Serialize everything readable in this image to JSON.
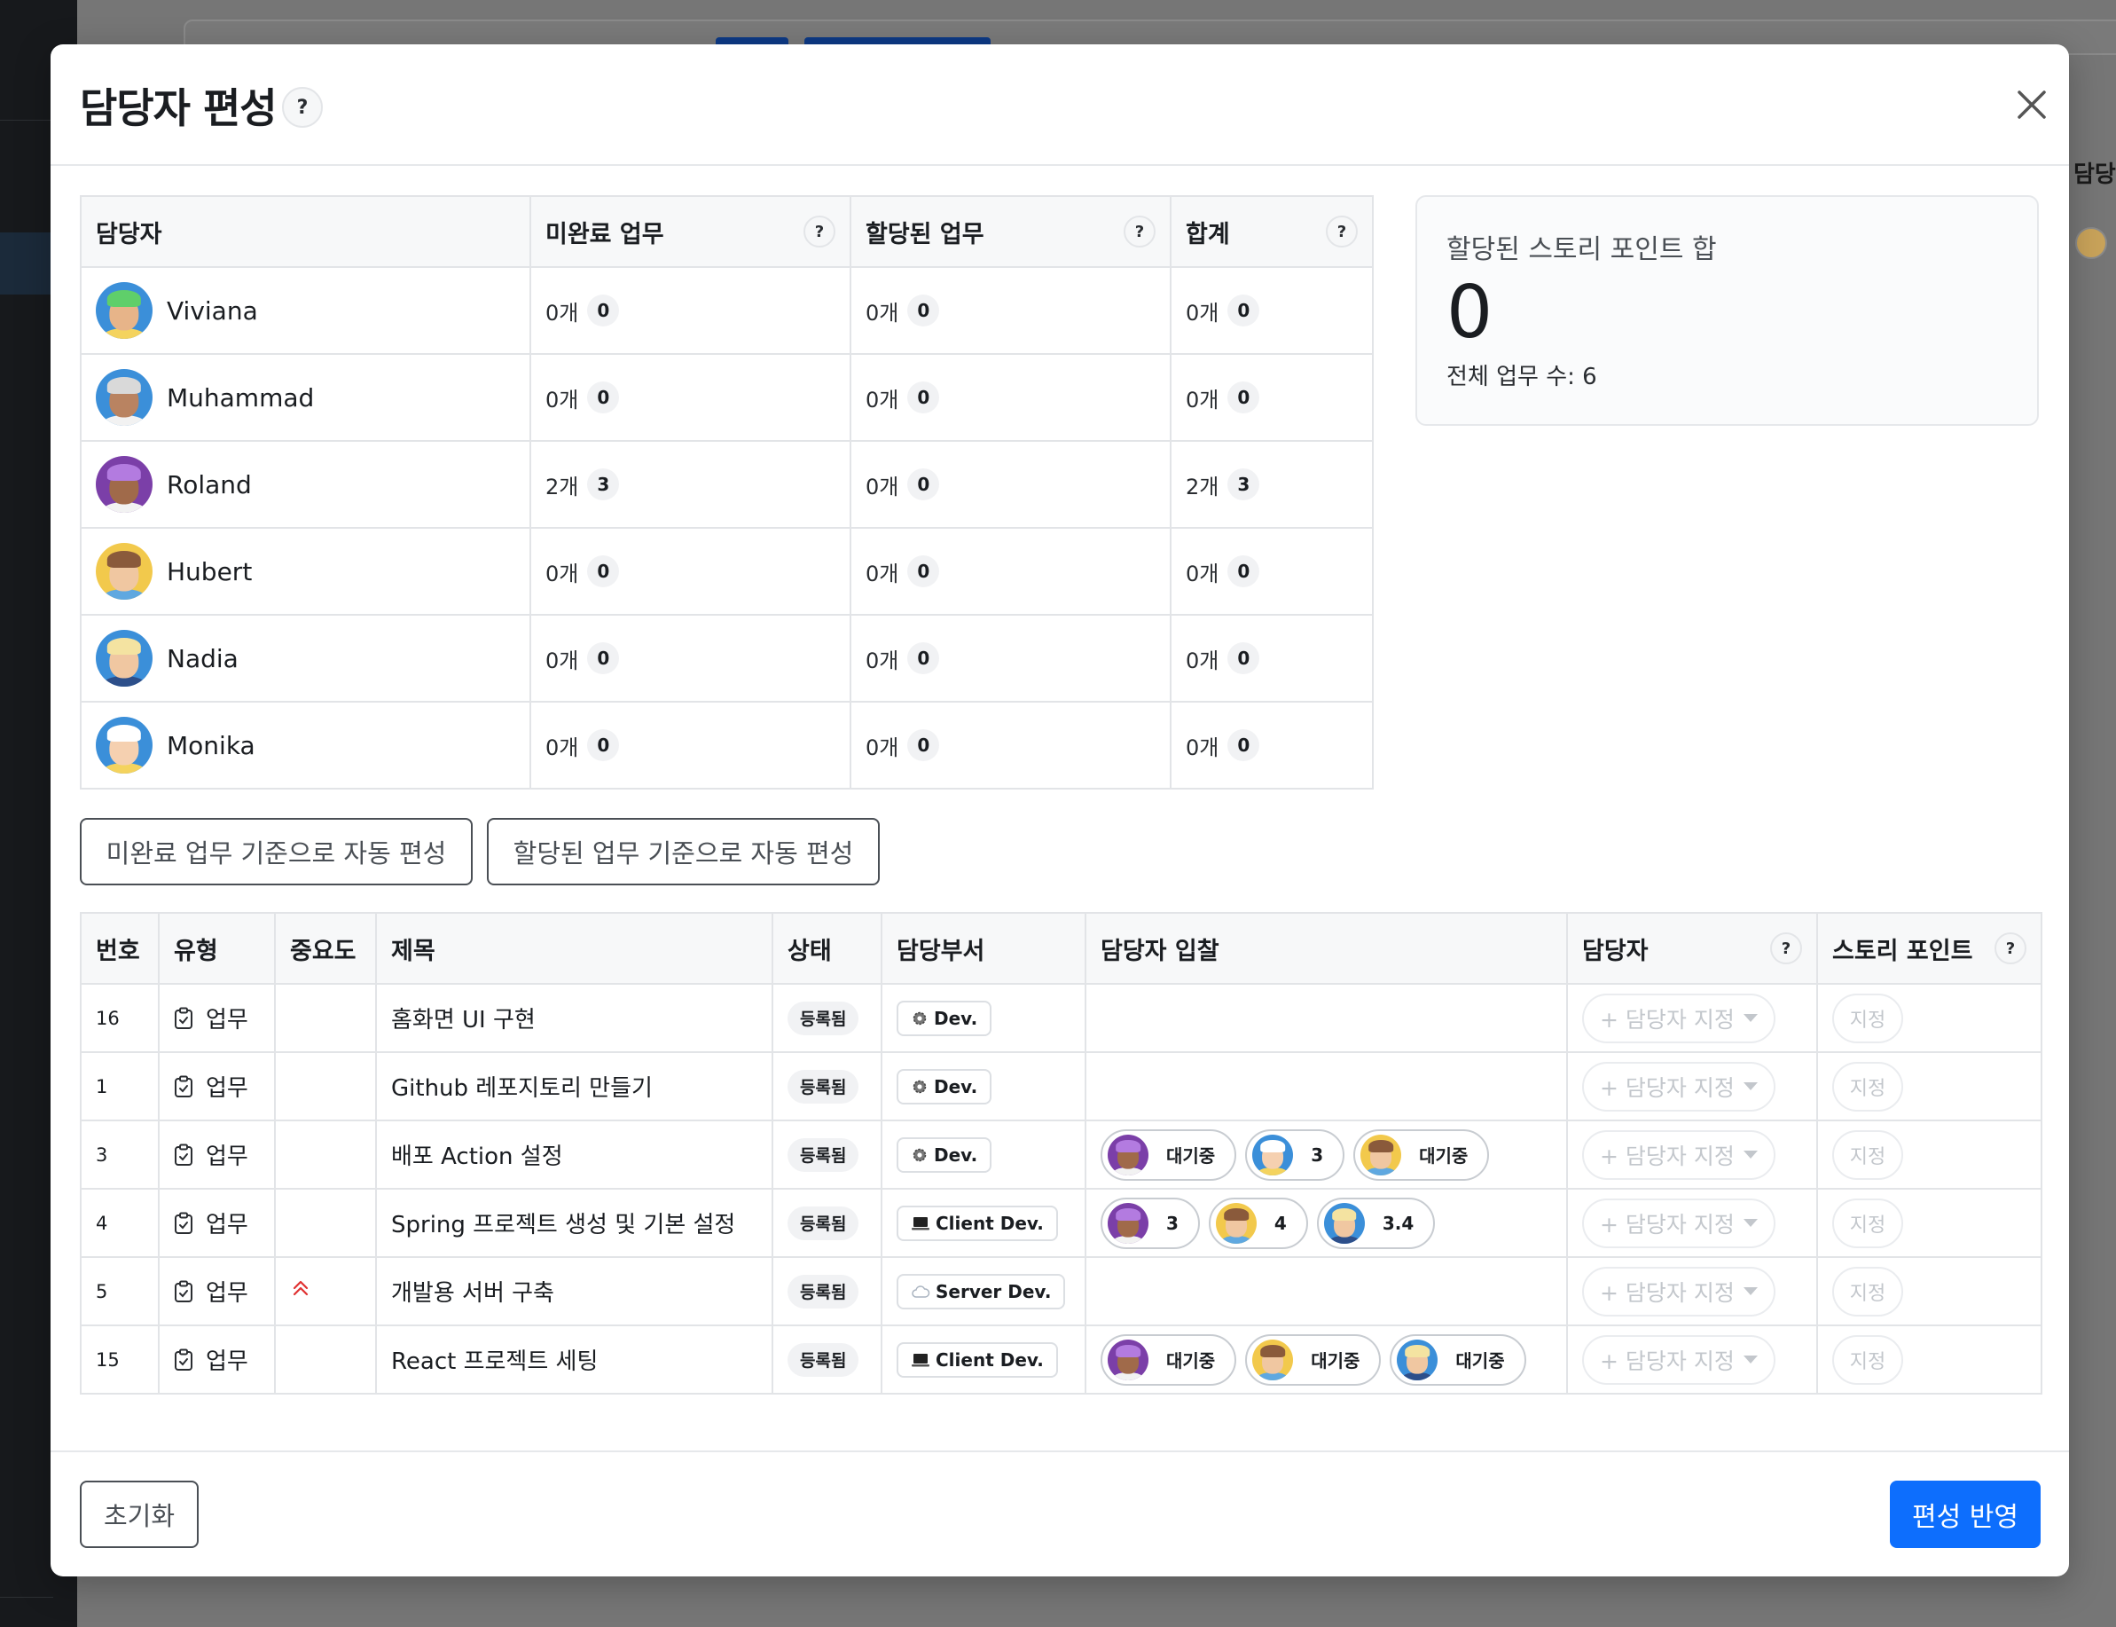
{
  "background": {
    "column_header": "담당"
  },
  "modal": {
    "title": "담당자 편성",
    "help": "?"
  },
  "summary": {
    "headers": {
      "assignee": "담당자",
      "incomplete": "미완료 업무",
      "assigned": "할당된 업무",
      "total": "합계"
    },
    "rows": [
      {
        "name": "Viviana",
        "incomplete_count": "0개",
        "incomplete_points": "0",
        "assigned_count": "0개",
        "assigned_points": "0",
        "total_count": "0개",
        "total_points": "0"
      },
      {
        "name": "Muhammad",
        "incomplete_count": "0개",
        "incomplete_points": "0",
        "assigned_count": "0개",
        "assigned_points": "0",
        "total_count": "0개",
        "total_points": "0"
      },
      {
        "name": "Roland",
        "incomplete_count": "2개",
        "incomplete_points": "3",
        "assigned_count": "0개",
        "assigned_points": "0",
        "total_count": "2개",
        "total_points": "3"
      },
      {
        "name": "Hubert",
        "incomplete_count": "0개",
        "incomplete_points": "0",
        "assigned_count": "0개",
        "assigned_points": "0",
        "total_count": "0개",
        "total_points": "0"
      },
      {
        "name": "Nadia",
        "incomplete_count": "0개",
        "incomplete_points": "0",
        "assigned_count": "0개",
        "assigned_points": "0",
        "total_count": "0개",
        "total_points": "0"
      },
      {
        "name": "Monika",
        "incomplete_count": "0개",
        "incomplete_points": "0",
        "assigned_count": "0개",
        "assigned_points": "0",
        "total_count": "0개",
        "total_points": "0"
      }
    ]
  },
  "stats": {
    "label": "할당된 스토리 포인트 합",
    "value": "0",
    "sub": "전체 업무 수: 6"
  },
  "actions": {
    "auto_incomplete": "미완료 업무 기준으로 자동 편성",
    "auto_assigned": "할당된 업무 기준으로 자동 편성"
  },
  "issues": {
    "headers": {
      "number": "번호",
      "type": "유형",
      "priority": "중요도",
      "title": "제목",
      "status": "상태",
      "dept": "담당부서",
      "bids": "담당자 입찰",
      "assignee": "담당자",
      "points": "스토리 포인트"
    },
    "assign_label": "+ 담당자 지정",
    "points_label": "지정",
    "rows": [
      {
        "number": "16",
        "type": "업무",
        "title": "홈화면 UI 구현",
        "status": "등록됨",
        "dept": "Dev.",
        "dept_icon": "gear-icon",
        "bids": []
      },
      {
        "number": "1",
        "type": "업무",
        "title": "Github 레포지토리 만들기",
        "status": "등록됨",
        "dept": "Dev.",
        "dept_icon": "gear-icon",
        "bids": []
      },
      {
        "number": "3",
        "type": "업무",
        "title": "배포 Action 설정",
        "status": "등록됨",
        "dept": "Dev.",
        "dept_icon": "gear-icon",
        "bids": [
          {
            "avatar": "Roland",
            "label": "대기중"
          },
          {
            "avatar": "Monika",
            "label": "3"
          },
          {
            "avatar": "Hubert",
            "label": "대기중"
          }
        ]
      },
      {
        "number": "4",
        "type": "업무",
        "title": "Spring 프로젝트 생성 및 기본 설정",
        "status": "등록됨",
        "dept": "Client Dev.",
        "dept_icon": "laptop-icon",
        "bids": [
          {
            "avatar": "Roland",
            "label": "3"
          },
          {
            "avatar": "Hubert",
            "label": "4"
          },
          {
            "avatar": "Nadia",
            "label": "3.4"
          }
        ]
      },
      {
        "number": "5",
        "type": "업무",
        "priority_icon": "double-chevron-up-icon",
        "title": "개발용 서버 구축",
        "status": "등록됨",
        "dept": "Server Dev.",
        "dept_icon": "cloud-icon",
        "bids": []
      },
      {
        "number": "15",
        "type": "업무",
        "title": "React 프로젝트 세팅",
        "status": "등록됨",
        "dept": "Client Dev.",
        "dept_icon": "laptop-icon",
        "bids": [
          {
            "avatar": "Roland",
            "label": "대기중"
          },
          {
            "avatar": "Hubert",
            "label": "대기중"
          },
          {
            "avatar": "Nadia",
            "label": "대기중"
          }
        ]
      }
    ]
  },
  "footer": {
    "reset": "초기화",
    "apply": "편성 반영"
  },
  "colors": {
    "primary": "#0d6efd",
    "priority_high": "#e03131"
  }
}
